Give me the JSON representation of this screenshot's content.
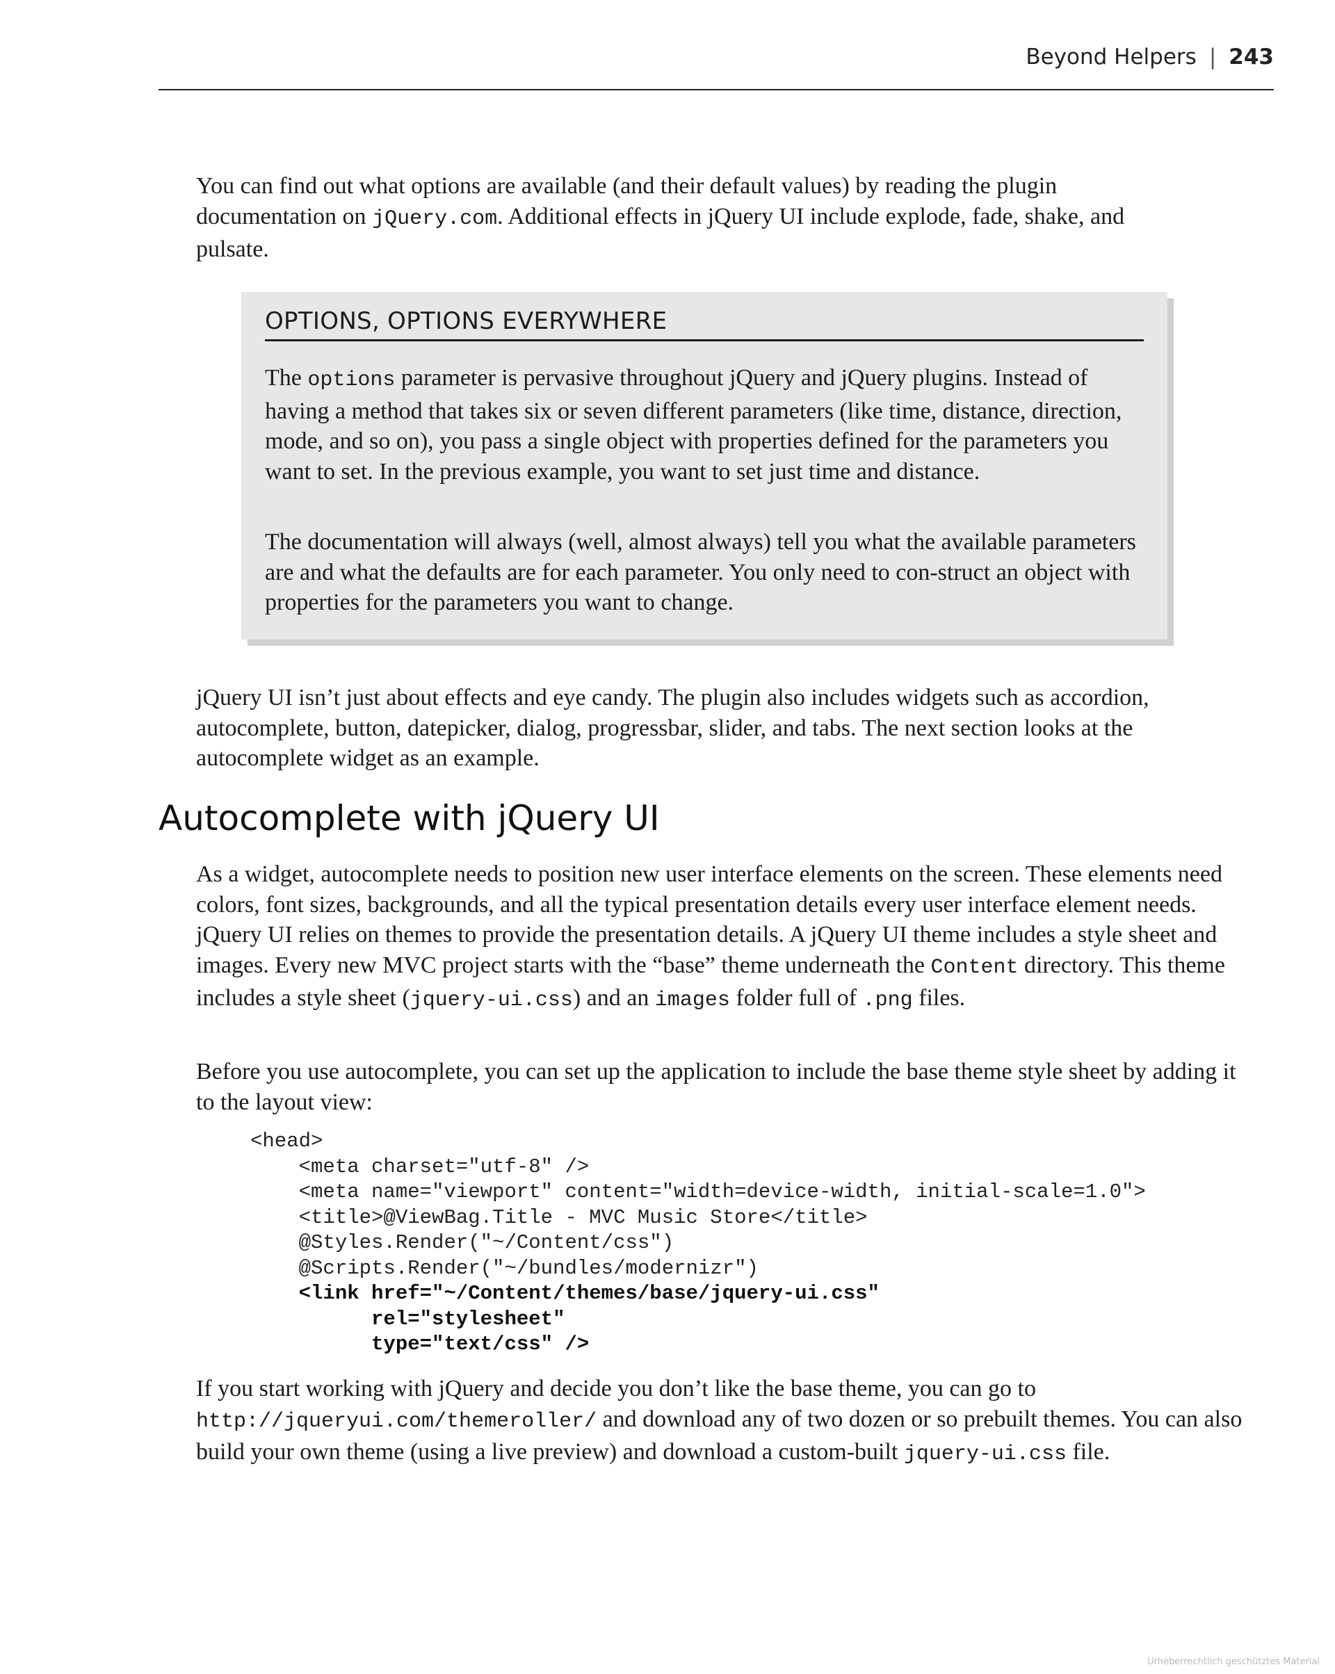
{
  "header": {
    "section_title": "Beyond Helpers",
    "separator": "|",
    "page_number": "243"
  },
  "paragraph1": {
    "part1": "You can find out what options are available (and their default values) by reading the plugin documentation on ",
    "code1": "jQuery.com",
    "part2": ". Additional effects in jQuery UI include explode, fade, shake, and pulsate."
  },
  "sidebar": {
    "title": "OPTIONS, OPTIONS EVERYWHERE",
    "p1_part1": "The ",
    "p1_code": "options",
    "p1_part2": " parameter is pervasive throughout jQuery and jQuery plugins. Instead of having a method that takes six or seven different parameters (like time, distance, direction, mode, and so on), you pass a single object with properties defined for the parameters you want to set. In the previous example, you want to set just time and distance.",
    "p2": "The documentation will always (well, almost always) tell you what the available parameters are and what the defaults are for each parameter. You only need to con-struct an object with properties for the parameters you want to change."
  },
  "paragraph2": "jQuery UI isn’t just about effects and eye candy. The plugin also includes widgets such as accordion, autocomplete, button, datepicker, dialog, progressbar, slider, and tabs. The next section looks at the autocomplete widget as an example.",
  "section_heading": "Autocomplete with jQuery UI",
  "paragraph3": {
    "part1": "As a widget, autocomplete needs to position new user interface elements on the screen. These elements need colors, font sizes, backgrounds, and all the typical presentation details every user interface element needs. jQuery UI relies on themes to provide the presentation details. A jQuery UI theme includes a style sheet and images. Every new MVC project starts with the “base” theme underneath the ",
    "code1": "Content",
    "part2": " directory. This theme includes a style sheet (",
    "code2": "jquery-ui.css",
    "part3": ") and an ",
    "code3": "images",
    "part4": " folder full of ",
    "code4": ".png",
    "part5": " files."
  },
  "paragraph4": "Before you use autocomplete, you can set up the application to include the base theme style sheet by adding it to the layout view:",
  "code_lines": [
    "<head>",
    "    <meta charset=\"utf-8\" />",
    "    <meta name=\"viewport\" content=\"width=device-width, initial-scale=1.0\">",
    "    <title>@ViewBag.Title - MVC Music Store</title>",
    "    @Styles.Render(\"~/Content/css\")",
    "    @Scripts.Render(\"~/bundles/modernizr\")",
    "    <link href=\"~/Content/themes/base/jquery-ui.css\"",
    "          rel=\"stylesheet\"",
    "          type=\"text/css\" />"
  ],
  "paragraph5": {
    "part1": "If you start working with jQuery and decide you don’t like the base theme, you can go to ",
    "code1": "http://jqueryui.com/themeroller/",
    "part2": " and download any of two dozen or so prebuilt themes. You can also build your own theme (using a live preview) and download a custom-built ",
    "code2": "jquery-ui.css",
    "part3": " file."
  },
  "watermark": "Urheberrechtlich geschütztes Material"
}
